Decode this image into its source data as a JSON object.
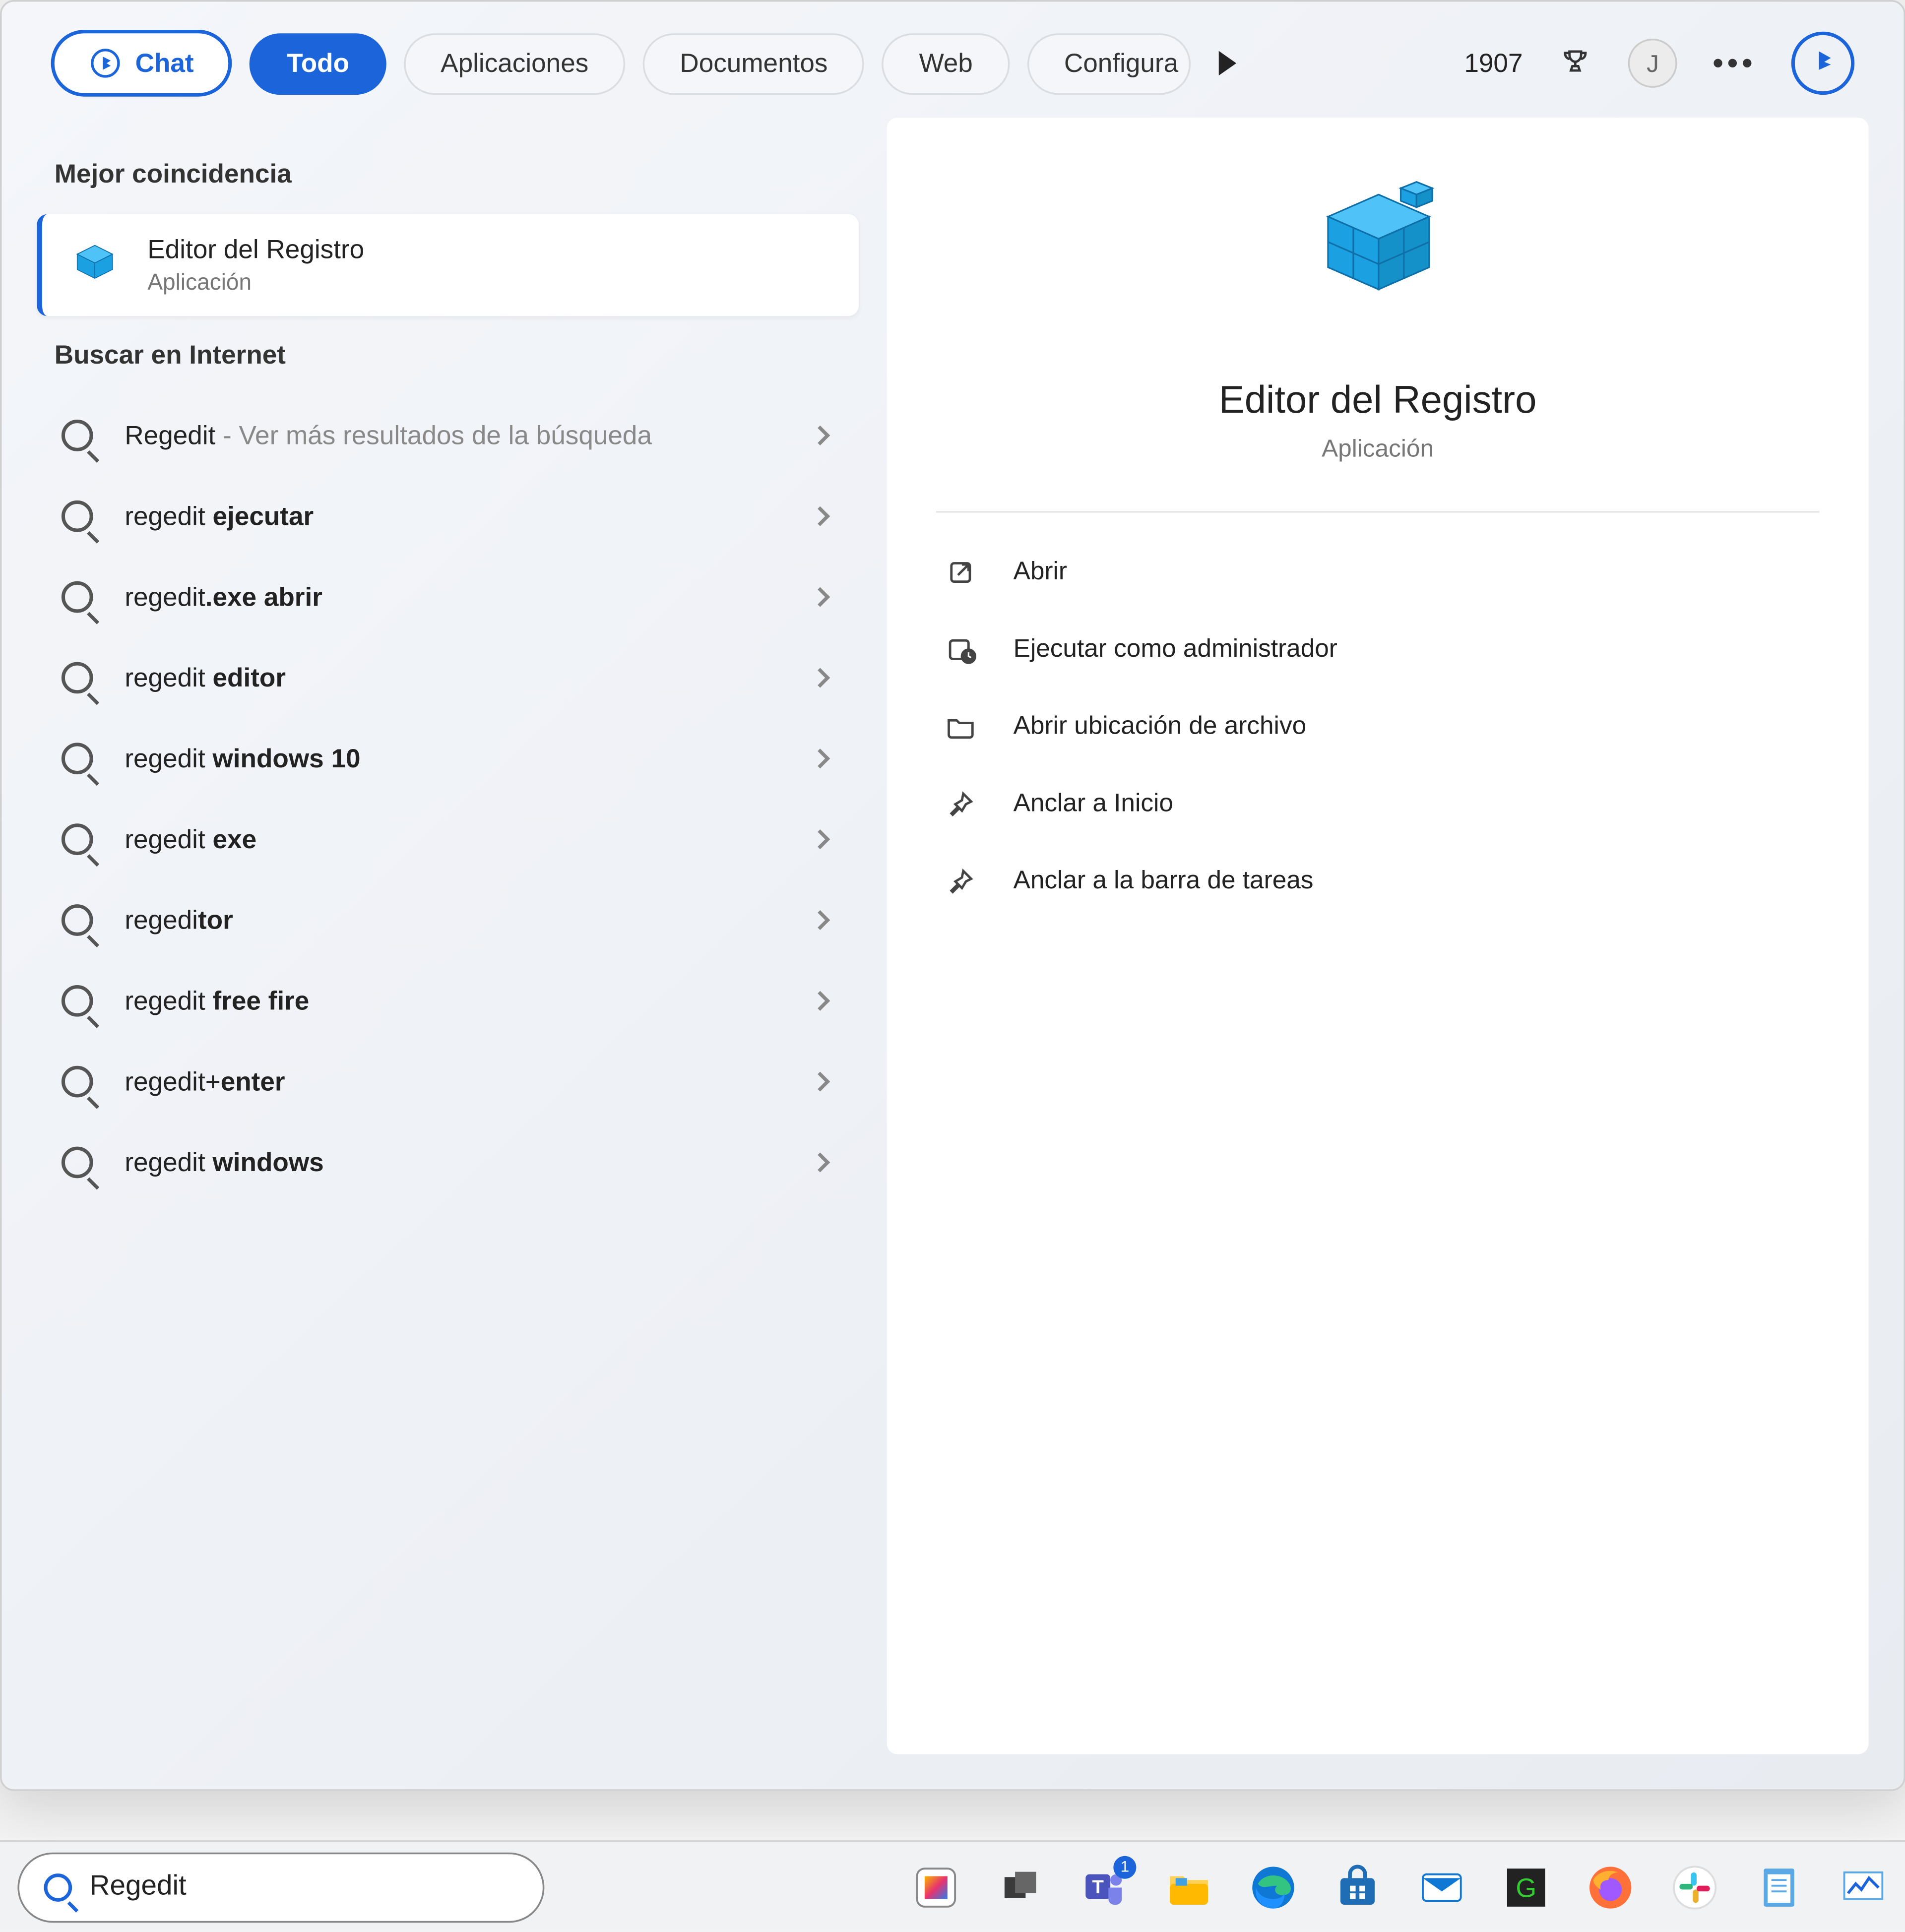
{
  "tabs": {
    "chat": "Chat",
    "all": "Todo",
    "apps": "Aplicaciones",
    "docs": "Documentos",
    "web": "Web",
    "config": "Configura"
  },
  "header": {
    "points": "1907",
    "avatarInitial": "J"
  },
  "left": {
    "bestMatchLabel": "Mejor coincidencia",
    "bestMatchTitle": "Editor del Registro",
    "bestMatchSub": "Aplicación",
    "internetLabel": "Buscar en Internet",
    "suggestions": [
      {
        "prefix": "Regedit",
        "sep": " - ",
        "rest": "Ver más resultados de la búsqueda",
        "gray": true
      },
      {
        "prefix": "regedit ",
        "bold": "ejecutar"
      },
      {
        "prefix": "regedit",
        "bold": ".exe abrir"
      },
      {
        "prefix": "regedit ",
        "bold": "editor"
      },
      {
        "prefix": "regedit ",
        "bold": "windows 10"
      },
      {
        "prefix": "regedit ",
        "bold": "exe"
      },
      {
        "prefix": "regedi",
        "bold": "tor"
      },
      {
        "prefix": "regedit ",
        "bold": "free fire"
      },
      {
        "prefix": "regedit+",
        "bold": "enter"
      },
      {
        "prefix": "regedit ",
        "bold": "windows"
      }
    ]
  },
  "right": {
    "title": "Editor del Registro",
    "sub": "Aplicación",
    "actions": {
      "open": "Abrir",
      "admin": "Ejecutar como administrador",
      "location": "Abrir ubicación de archivo",
      "pinStart": "Anclar a Inicio",
      "pinTaskbar": "Anclar a la barra de tareas"
    }
  },
  "taskbar": {
    "searchValue": "Regedit",
    "teamsBadge": "1"
  }
}
